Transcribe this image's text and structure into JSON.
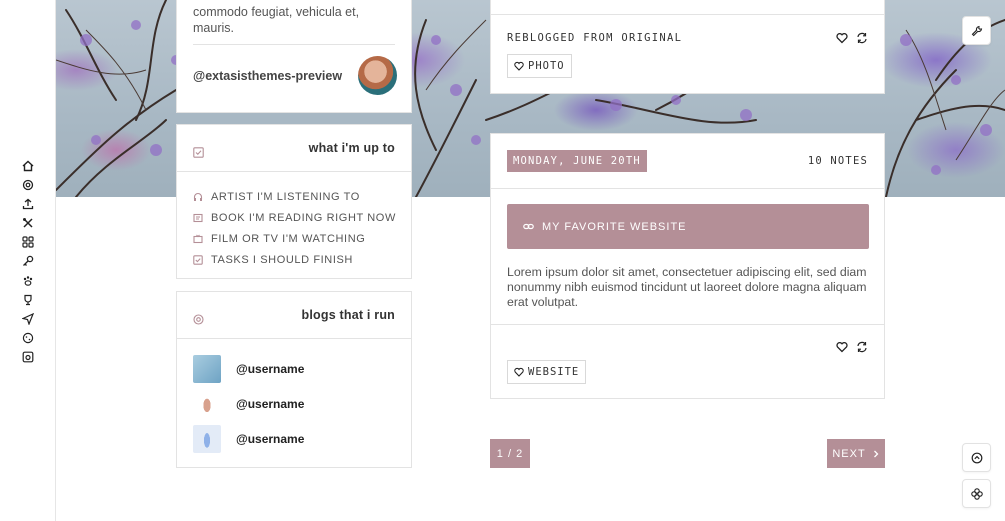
{
  "colors": {
    "accent": "#b48f97",
    "text": "#555555",
    "border": "#e3e3e3"
  },
  "rail": {
    "icons": [
      "home-icon",
      "at-icon",
      "upload-icon",
      "tools-icon",
      "grid-icon",
      "key-icon",
      "paw-icon",
      "trophy-icon",
      "send-icon",
      "cookie-icon",
      "camera-icon"
    ]
  },
  "about": {
    "text": "commodo feugiat, vehicula et, mauris.",
    "username": "@extasisthemes-preview"
  },
  "upto": {
    "title": "what i'm up to",
    "items": [
      {
        "icon": "headphones-icon",
        "label": "ARTIST I'M LISTENING TO"
      },
      {
        "icon": "book-icon",
        "label": "BOOK I'M READING RIGHT NOW"
      },
      {
        "icon": "tv-icon",
        "label": "FILM OR TV I'M WATCHING"
      },
      {
        "icon": "checkbox-icon",
        "label": "TASKS I SHOULD FINISH"
      }
    ]
  },
  "blogs": {
    "title": "blogs that i run",
    "items": [
      {
        "name": "@username"
      },
      {
        "name": "@username"
      },
      {
        "name": "@username"
      }
    ]
  },
  "post1": {
    "reblog_text": "REBLOGGED FROM ORIGINAL",
    "tag": "PHOTO"
  },
  "post2": {
    "date": "MONDAY, JUNE 20TH",
    "notes": "10 NOTES",
    "link_label": "MY FAVORITE WEBSITE",
    "body": "Lorem ipsum dolor sit amet, consectetuer adipiscing elit, sed diam nonummy nibh euismod tincidunt ut laoreet dolore magna aliquam erat volutpat.",
    "tag": "WEBSITE"
  },
  "pager": {
    "page": "1 / 2",
    "next": "NEXT"
  }
}
